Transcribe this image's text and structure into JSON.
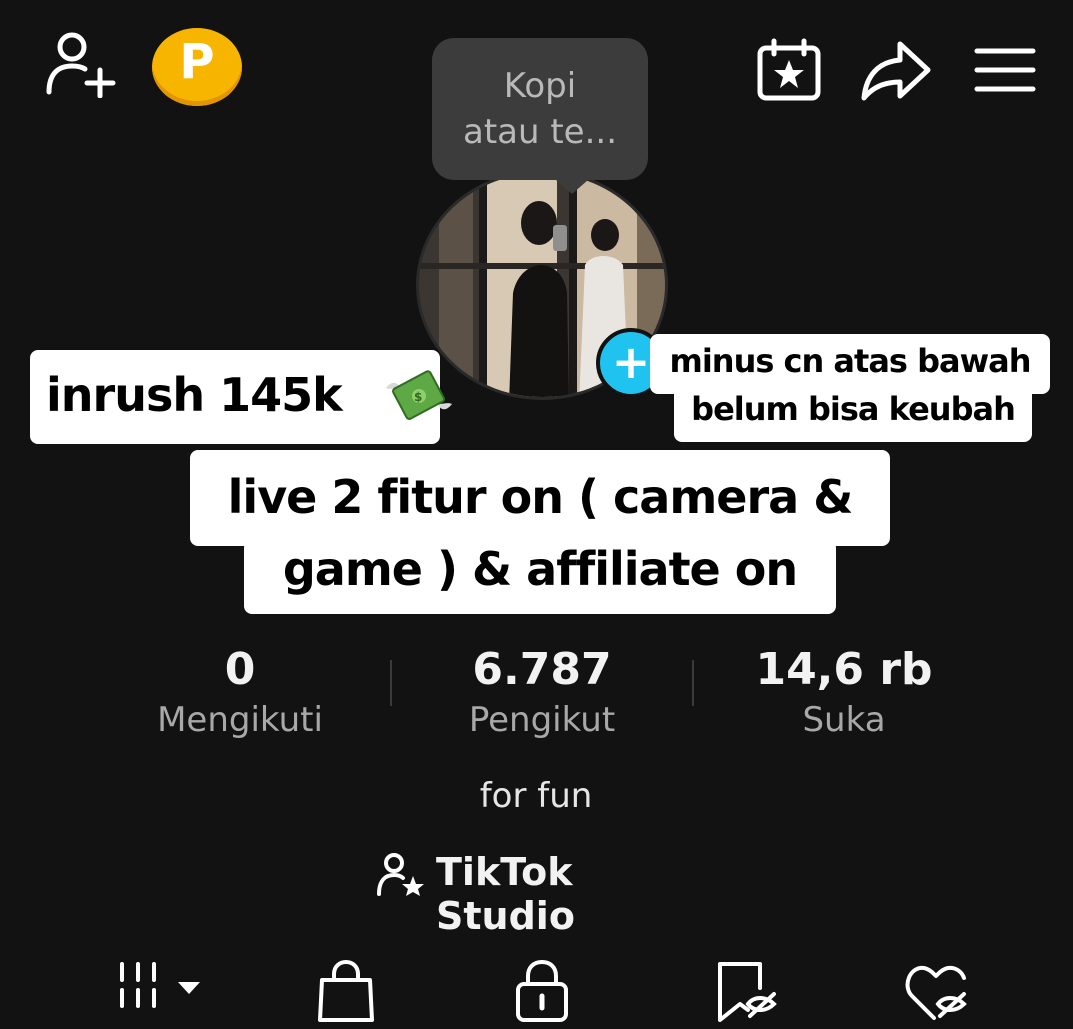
{
  "tooltip": {
    "line1": "Kopi",
    "line2": "atau te..."
  },
  "header": {
    "add_friend_icon": "person-plus-icon",
    "points_icon": "coin-p-icon",
    "points_letter": "P",
    "calendar_icon": "calendar-star-icon",
    "share_icon": "share-arrow-icon",
    "menu_icon": "hamburger-menu-icon"
  },
  "avatar": {
    "add_icon": "plus-icon",
    "add_symbol": "+"
  },
  "stickers": {
    "inrush": "inrush 145k",
    "inrush_emoji": "flying-money-icon",
    "minus_line1": "minus cn atas bawah",
    "minus_line2": "belum bisa keubah",
    "live_line1": "live 2 fitur on ( camera &",
    "live_line2": "game ) & affiliate on"
  },
  "stats": [
    {
      "value": "0",
      "label": "Mengikuti"
    },
    {
      "value": "6.787",
      "label": "Pengikut"
    },
    {
      "value": "14,6 rb",
      "label": "Suka"
    }
  ],
  "bio": "for fun",
  "studio": {
    "icon": "person-star-icon",
    "label": "TikTok Studio"
  },
  "tabs": [
    {
      "icon": "grid-icon"
    },
    {
      "icon": "shopping-bag-icon"
    },
    {
      "icon": "lock-icon"
    },
    {
      "icon": "bookmark-hidden-icon"
    },
    {
      "icon": "heart-hidden-icon"
    }
  ],
  "colors": {
    "background": "#121212",
    "points_badge": "#f7b500",
    "add_avatar_button": "#20c3f0",
    "sticker_bg": "#ffffff"
  }
}
